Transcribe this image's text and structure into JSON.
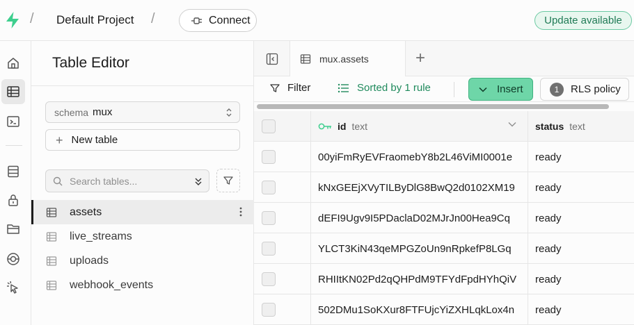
{
  "header": {
    "project_name": "Default Project",
    "breadcrumb_separator": "/",
    "connect_label": "Connect",
    "update_label": "Update available"
  },
  "rail": {
    "items": [
      {
        "icon": "home-icon"
      },
      {
        "icon": "table-editor-icon",
        "active": true
      },
      {
        "icon": "sql-editor-icon"
      },
      {
        "icon": "database-icon"
      },
      {
        "icon": "auth-lock-icon"
      },
      {
        "icon": "storage-folder-icon"
      },
      {
        "icon": "realtime-icon"
      },
      {
        "icon": "advisor-pointer-icon"
      }
    ]
  },
  "panel": {
    "title": "Table Editor",
    "schema_key": "schema",
    "schema_value": "mux",
    "new_table_label": "New table",
    "search_placeholder": "Search tables...",
    "tables": [
      {
        "name": "assets",
        "active": true
      },
      {
        "name": "live_streams"
      },
      {
        "name": "uploads"
      },
      {
        "name": "webhook_events"
      }
    ]
  },
  "main": {
    "tab_label": "mux.assets",
    "toolbar": {
      "filter_label": "Filter",
      "sort_label": "Sorted by 1 rule",
      "insert_label": "Insert",
      "rls_count": "1",
      "rls_label": "RLS policy"
    },
    "columns": [
      {
        "name": "id",
        "type": "text"
      },
      {
        "name": "status",
        "type": "text"
      }
    ],
    "rows": [
      {
        "id": "00yiFmRyEVFraomebY8b2L46ViMI0001e",
        "status": "ready"
      },
      {
        "id": "kNxGEEjXVyTILByDlG8BwQ2d0102XM19",
        "status": "ready"
      },
      {
        "id": "dEFI9Ugv9I5PDaclaD02MJrJn00Hea9Cq",
        "status": "ready"
      },
      {
        "id": "YLCT3KiN43qeMPGZoUn9nRpkefP8LGq",
        "status": "ready"
      },
      {
        "id": "RHIItKN02Pd2qQHPdM9TFYdFpdHYhQiV",
        "status": "ready"
      },
      {
        "id": "502DMu1SoKXur8FTFUjcYiZXHLqkLox4n",
        "status": "ready"
      }
    ]
  },
  "colors": {
    "accent_green": "#6ed6a8",
    "sort_green": "#1f8a5c",
    "update_badge_bg": "#e8f7ef"
  }
}
